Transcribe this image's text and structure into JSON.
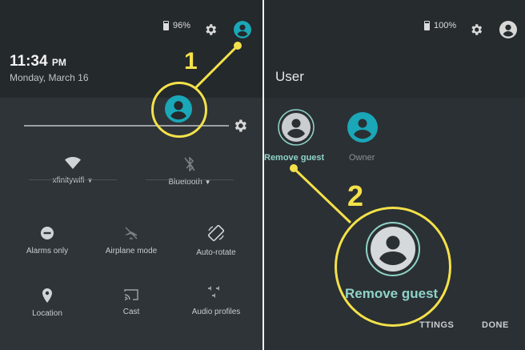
{
  "left": {
    "battery": "96%",
    "time": "11:34",
    "ampm": "PM",
    "date": "Monday, March 16",
    "tiles": [
      {
        "label": "xfinitywifi",
        "icon": "wifi-icon",
        "dropdown": true
      },
      {
        "label": "Bluetooth",
        "icon": "bluetooth-off-icon",
        "dropdown": true
      },
      {
        "label": "Alarms only",
        "icon": "do-not-disturb-icon"
      },
      {
        "label": "Airplane mode",
        "icon": "airplane-off-icon"
      },
      {
        "label": "Auto-rotate",
        "icon": "auto-rotate-icon"
      },
      {
        "label": "Location",
        "icon": "location-pin-icon"
      },
      {
        "label": "Cast",
        "icon": "cast-icon"
      },
      {
        "label": "Audio profiles",
        "icon": "audio-profiles-icon"
      }
    ]
  },
  "right": {
    "battery": "100%",
    "title": "User",
    "users": [
      {
        "label": "Remove guest",
        "icon": "guest-user-icon"
      },
      {
        "label": "Owner",
        "icon": "owner-user-icon"
      }
    ],
    "zoom_label": "Remove guest",
    "settings_button": "TTINGS",
    "done_button": "DONE"
  },
  "callouts": {
    "one": "1",
    "two": "2"
  },
  "colors": {
    "callout": "#f4e14a",
    "accent_teal": "#1aa7b8",
    "guest_label": "#8fd3c8"
  }
}
